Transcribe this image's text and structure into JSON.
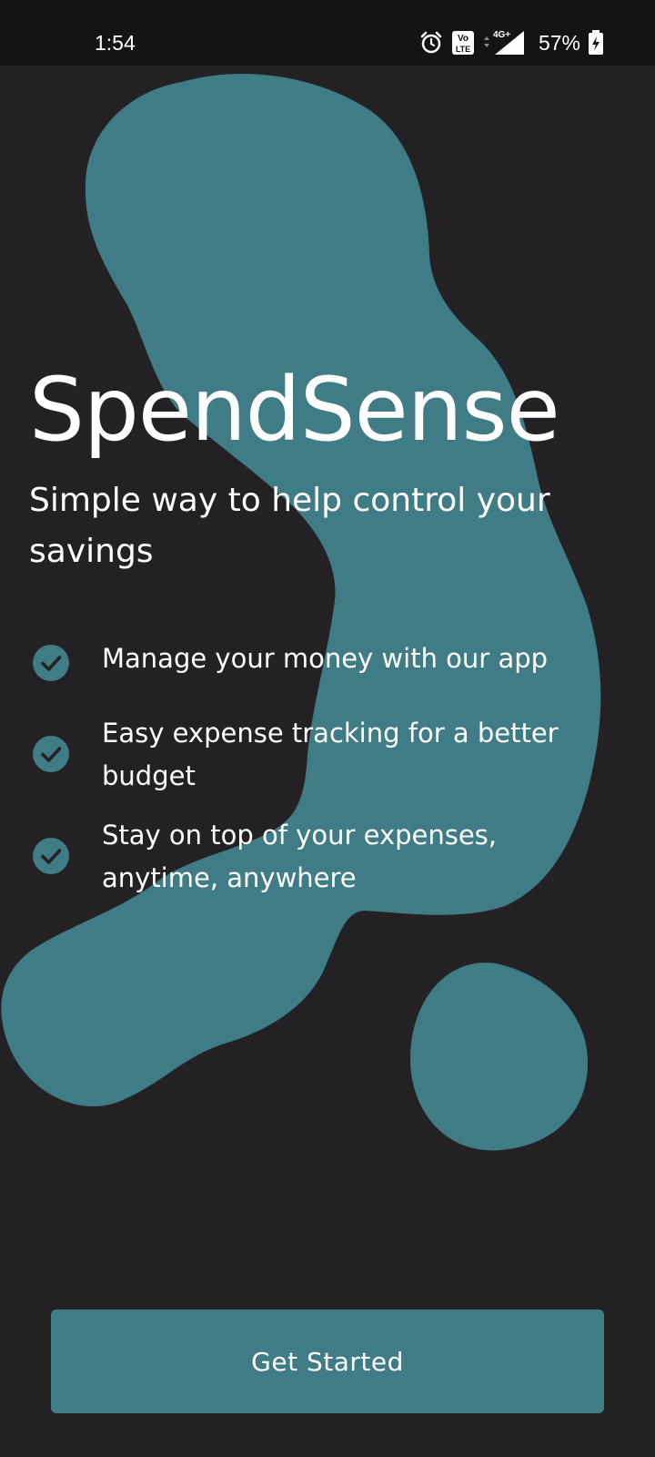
{
  "status_bar": {
    "time": "1:54",
    "battery": "57%",
    "icons": [
      "alarm-icon",
      "volte-icon",
      "signal-4g-icon",
      "battery-charging-icon"
    ],
    "network_label": "4G+",
    "volte_label_top": "Vo",
    "volte_label_bottom": "LTE"
  },
  "onboarding": {
    "title": "SpendSense",
    "subtitle": "Simple way to help control your savings",
    "features": [
      "Manage your money with our app",
      "Easy expense tracking for a better budget",
      "Stay on top of your expenses, anytime, anywhere"
    ],
    "cta_label": "Get Started"
  },
  "colors": {
    "background": "#232124",
    "accent": "#3f7c86",
    "status_bar": "#141414",
    "text": "#ffffff"
  }
}
